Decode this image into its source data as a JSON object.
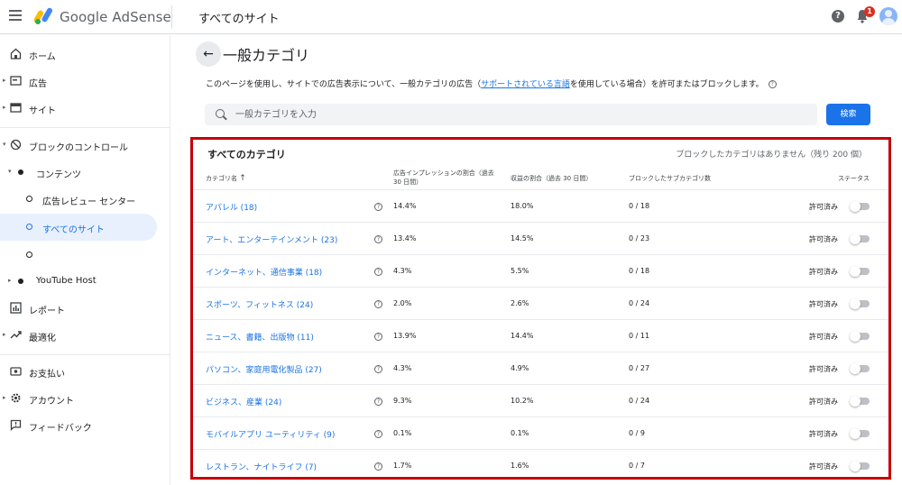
{
  "header": {
    "brand": "Google AdSense",
    "page": "すべてのサイト",
    "help_icon": "help-icon",
    "notification_count": "1"
  },
  "sidebar": {
    "items": [
      {
        "label": "ホーム",
        "icon": "home-icon"
      },
      {
        "label": "広告",
        "icon": "ads-icon"
      },
      {
        "label": "サイト",
        "icon": "sites-icon"
      },
      {
        "label": "ブロックのコントロール",
        "icon": "block-icon"
      },
      {
        "label": "コンテンツ"
      },
      {
        "label": "広告レビュー センター"
      },
      {
        "label": "すべてのサイト"
      },
      {
        "label": ""
      },
      {
        "label": "YouTube Host"
      },
      {
        "label": "レポート",
        "icon": "reports-icon"
      },
      {
        "label": "最適化",
        "icon": "optimize-icon"
      },
      {
        "label": "お支払い",
        "icon": "payments-icon"
      },
      {
        "label": "アカウント",
        "icon": "gear-icon"
      },
      {
        "label": "フィードバック",
        "icon": "feedback-icon"
      }
    ]
  },
  "main": {
    "title": "一般カテゴリ",
    "description_pre": "このページを使用し、サイトでの広告表示について、一般カテゴリの広告（",
    "description_link": "サポートされている言語",
    "description_post": "を使用している場合）を許可またはブロックします。",
    "search_placeholder": "一般カテゴリを入力",
    "search_button": "検索"
  },
  "table": {
    "title": "すべてのカテゴリ",
    "note": "ブロックしたカテゴリはありません（残り 200 個）",
    "headers": {
      "name": "カテゴリ名",
      "impressions_line1": "広告インプレッションの割合（過去",
      "impressions_line2": "30 日間）",
      "revenue": "収益の割合（過去 30 日間）",
      "blocked": "ブロックしたサブカテゴリ数",
      "status": "ステータス"
    },
    "rows": [
      {
        "name": "アパレル (18)",
        "impressions": "14.4%",
        "revenue": "18.0%",
        "blocked": "0 / 18",
        "status": "許可済み"
      },
      {
        "name": "アート、エンターテインメント (23)",
        "impressions": "13.4%",
        "revenue": "14.5%",
        "blocked": "0 / 23",
        "status": "許可済み"
      },
      {
        "name": "インターネット、通信事業 (18)",
        "impressions": "4.3%",
        "revenue": "5.5%",
        "blocked": "0 / 18",
        "status": "許可済み"
      },
      {
        "name": "スポーツ、フィットネス (24)",
        "impressions": "2.0%",
        "revenue": "2.6%",
        "blocked": "0 / 24",
        "status": "許可済み"
      },
      {
        "name": "ニュース、書籍、出版物 (11)",
        "impressions": "13.9%",
        "revenue": "14.4%",
        "blocked": "0 / 11",
        "status": "許可済み"
      },
      {
        "name": "パソコン、家庭用電化製品 (27)",
        "impressions": "4.3%",
        "revenue": "4.9%",
        "blocked": "0 / 27",
        "status": "許可済み"
      },
      {
        "name": "ビジネス、産業 (24)",
        "impressions": "9.3%",
        "revenue": "10.2%",
        "blocked": "0 / 24",
        "status": "許可済み"
      },
      {
        "name": "モバイルアプリ ユーティリティ (9)",
        "impressions": "0.1%",
        "revenue": "0.1%",
        "blocked": "0 / 9",
        "status": "許可済み"
      },
      {
        "name": "レストラン、ナイトライフ (7)",
        "impressions": "1.7%",
        "revenue": "1.6%",
        "blocked": "0 / 7",
        "status": "許可済み"
      }
    ]
  },
  "colors": {
    "accent": "#1a73e8",
    "highlight_border": "#c5000b",
    "badge": "#d93025"
  }
}
